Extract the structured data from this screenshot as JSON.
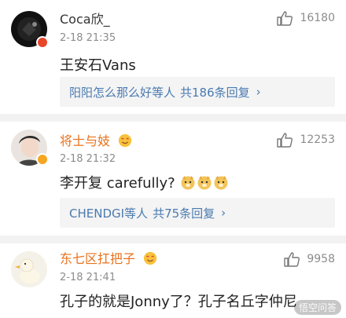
{
  "comments": [
    {
      "username": "Coca欣_",
      "time": "2-18 21:35",
      "likes": "16180",
      "text": "王安石Vans",
      "reply_names": "阳阳怎么那么好等人",
      "reply_count": "共186条回复",
      "chevron": "›",
      "avatar_icon": "dark-logo-avatar-icon",
      "badge_color": "#e8462b"
    },
    {
      "username": "将士与妓",
      "time": "2-18 21:32",
      "likes": "12253",
      "text": "李开复 carefully?",
      "reply_names": "CHENDGI等人",
      "reply_count": "共75条回复",
      "chevron": "›",
      "avatar_icon": "person-photo-avatar-icon",
      "badge_color": "#f5a623"
    },
    {
      "username": "东七区扛把子",
      "time": "2-18 21:41",
      "likes": "9958",
      "text": "孔子的就是Jonny了？孔子名丘字仲尼",
      "avatar_icon": "duck-avatar-icon"
    }
  ],
  "colors": {
    "username": "#e8721c",
    "first_username": "#333333",
    "link": "#4a7ab0",
    "meta": "#8c8c8c"
  },
  "watermark": "悟空问答"
}
